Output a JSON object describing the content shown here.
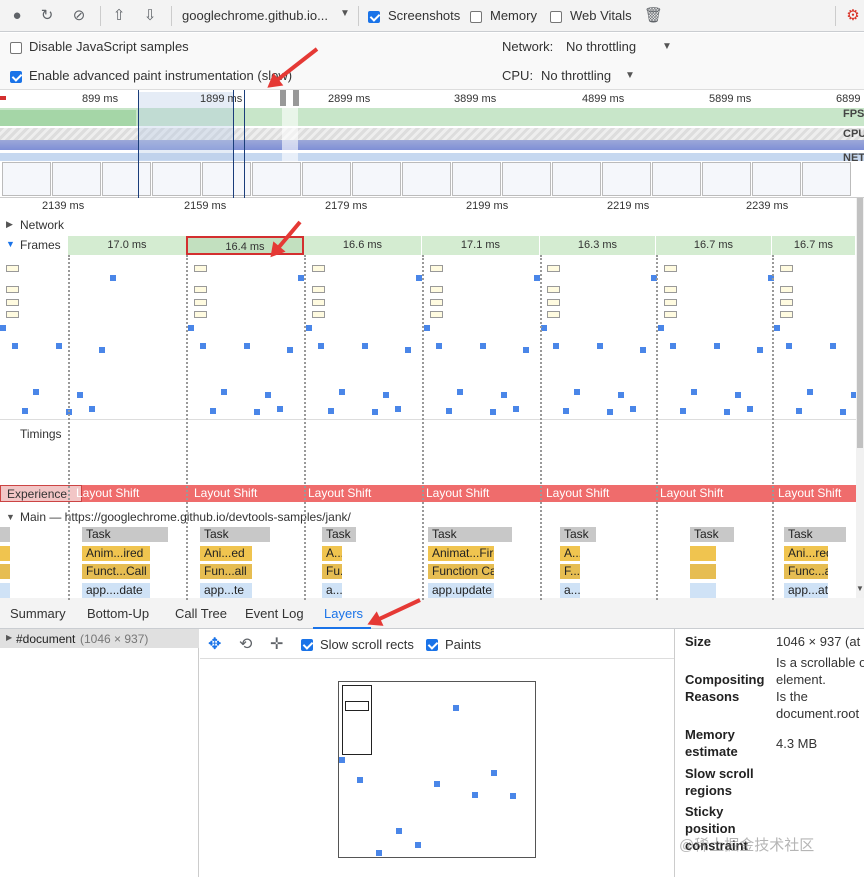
{
  "toolbar": {
    "url": "googlechrome.github.io...",
    "screenshots_label": "Screenshots",
    "memory_label": "Memory",
    "web_vitals_label": "Web Vitals"
  },
  "settings": {
    "disable_js_label": "Disable JavaScript samples",
    "advanced_paint_label": "Enable advanced paint instrumentation (slow)",
    "network_label": "Network:",
    "network_value": "No throttling",
    "cpu_label": "CPU:",
    "cpu_value": "No throttling"
  },
  "overview": {
    "ticks": [
      "899 ms",
      "1899 ms",
      "2899 ms",
      "3899 ms",
      "4899 ms",
      "5899 ms",
      "6899"
    ],
    "fps_label": "FPS",
    "cpu_label": "CPU",
    "net_label": "NET"
  },
  "ruler": {
    "ticks": [
      "2139 ms",
      "2159 ms",
      "2179 ms",
      "2199 ms",
      "2219 ms",
      "2239 ms"
    ]
  },
  "tracks": {
    "network_label": "Network",
    "frames_label": "Frames",
    "timings_label": "Timings",
    "experience_label": "Experience",
    "main_label": "Main — https://googlechrome.github.io/devtools-samples/jank/"
  },
  "frames": [
    "17.0 ms",
    "16.4 ms",
    "16.6 ms",
    "17.1 ms",
    "16.3 ms",
    "16.7 ms",
    "16.7 ms"
  ],
  "layout_shift_label": "Layout Shift",
  "main_tasks": [
    {
      "task": "Task",
      "a": "Anim...ired",
      "b": "Funct...Call",
      "c": "app....date"
    },
    {
      "task": "Task",
      "a": "Ani...ed",
      "b": "Fun...all",
      "c": "app...te"
    },
    {
      "task": "Task",
      "a": "A...d",
      "b": "Fu...l",
      "c": "a...e"
    },
    {
      "task": "Task",
      "a": "Animat...Fired",
      "b": "Function Call",
      "c": "app.update"
    },
    {
      "task": "Task",
      "a": "A...",
      "b": "F...l",
      "c": "a...e"
    },
    {
      "task": "Task",
      "a": "",
      "b": "",
      "c": ""
    },
    {
      "task": "Task",
      "a": "Ani...red",
      "b": "Func...all",
      "c": "app...ate"
    }
  ],
  "bottom_tabs": [
    "Summary",
    "Bottom-Up",
    "Call Tree",
    "Event Log",
    "Layers"
  ],
  "layer_tree": {
    "name": "#document",
    "size": "(1046 × 937)"
  },
  "layer_toolbar": {
    "slow_scroll_label": "Slow scroll rects",
    "paints_label": "Paints"
  },
  "props": {
    "size_key": "Size",
    "size_val": "1046 × 937 (at",
    "comp_key_1": "Compositing",
    "comp_key_2": "Reasons",
    "comp_val_1": "Is a scrollable o",
    "comp_val_2": "element.",
    "comp_val_3": "Is the",
    "comp_val_4": "document.root",
    "mem_key_1": "Memory",
    "mem_key_2": "estimate",
    "mem_val": "4.3 MB",
    "scroll_key_1": "Slow scroll",
    "scroll_key_2": "regions",
    "sticky_key_1": "Sticky",
    "sticky_key_2": "position",
    "sticky_key_3": "constraint"
  },
  "watermark": "@稀土掘金技术社区"
}
